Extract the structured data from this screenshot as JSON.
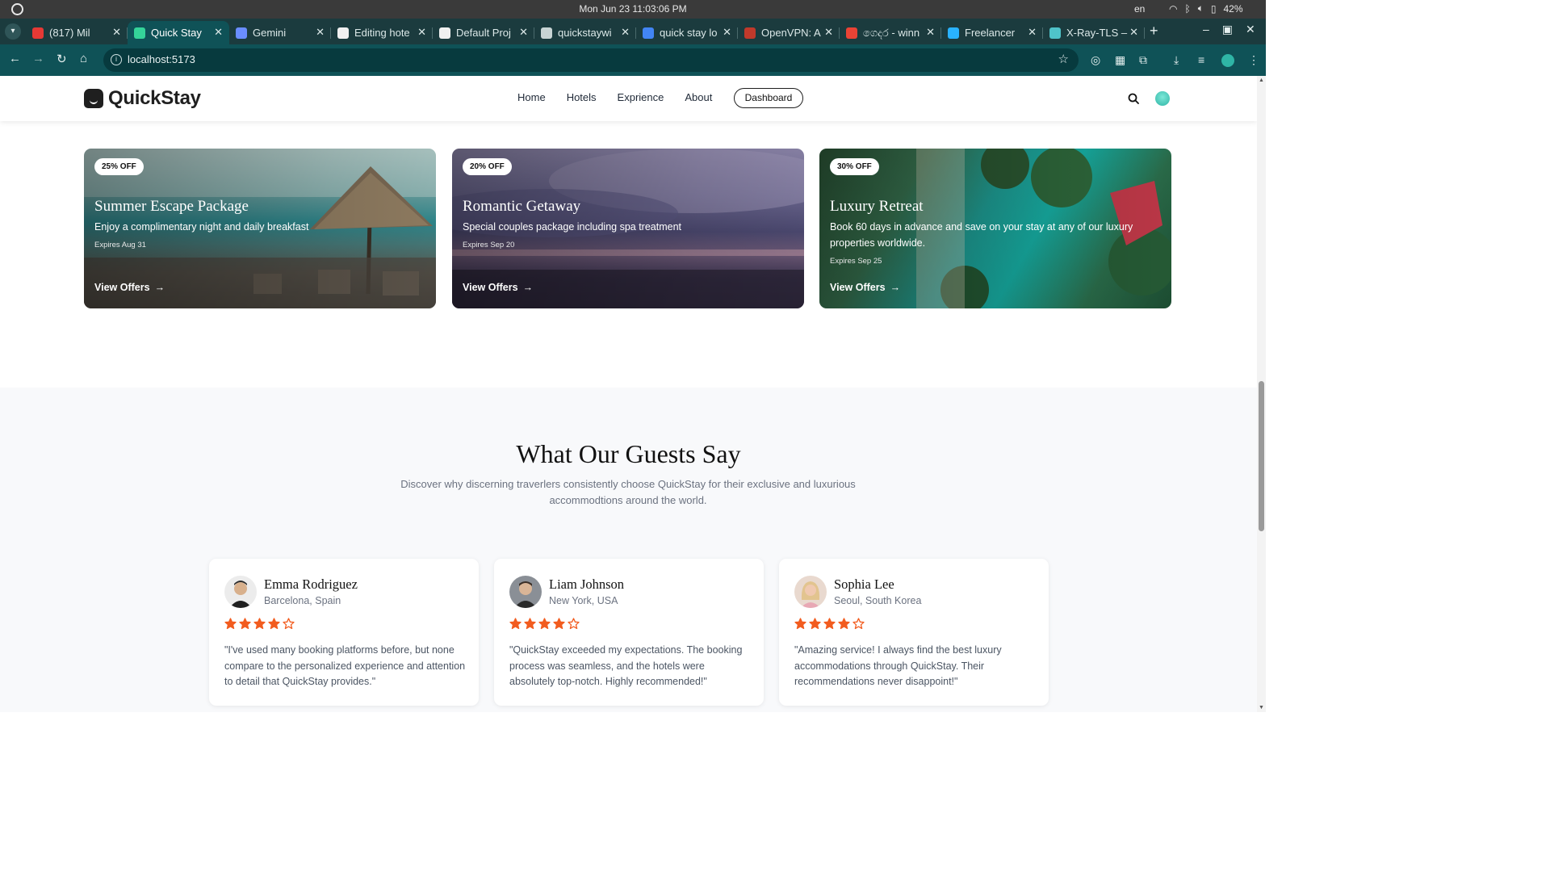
{
  "os": {
    "clock": "Mon Jun 23  11:03:06 PM",
    "lang": "en",
    "battery": "42%"
  },
  "tabs": [
    {
      "title": "(817) Mil",
      "favicon_color": "#e53935",
      "active": false
    },
    {
      "title": "Quick Stay",
      "favicon_color": "#34d399",
      "active": true
    },
    {
      "title": "Gemini",
      "favicon_color": "#6a8dff",
      "active": false
    },
    {
      "title": "Editing hote",
      "favicon_color": "#f0f0f0",
      "active": false
    },
    {
      "title": "Default Proj",
      "favicon_color": "#f0f0f0",
      "active": false
    },
    {
      "title": "quickstaywi",
      "favicon_color": "#c8d4d4",
      "active": false
    },
    {
      "title": "quick stay lo",
      "favicon_color": "#4285f4",
      "active": false
    },
    {
      "title": "OpenVPN: A",
      "favicon_color": "#c0392b",
      "active": false
    },
    {
      "title": "ගෙදර - winn",
      "favicon_color": "#ea4335",
      "active": false
    },
    {
      "title": "Freelancer",
      "favicon_color": "#29b2fe",
      "active": false
    },
    {
      "title": "X-Ray-TLS –",
      "favicon_color": "#4fc3c9",
      "active": false
    }
  ],
  "address_bar": {
    "url": "localhost:5173"
  },
  "site": {
    "brand": "QuickStay",
    "menu": [
      "Home",
      "Hotels",
      "Exprience",
      "About"
    ],
    "dashboard_label": "Dashboard"
  },
  "offers": [
    {
      "badge": "25% OFF",
      "title": "Summer Escape Package",
      "description": "Enjoy a complimentary night and daily breakfast",
      "expires": "Expires Aug 31",
      "link": "View Offers"
    },
    {
      "badge": "20% OFF",
      "title": "Romantic Getaway",
      "description": "Special couples package including spa treatment",
      "expires": "Expires Sep 20",
      "link": "View Offers"
    },
    {
      "badge": "30% OFF",
      "title": "Luxury Retreat",
      "description": "Book 60 days in advance and save on your stay at any of our luxury properties worldwide.",
      "expires": "Expires Sep 25",
      "link": "View Offers"
    }
  ],
  "testimonials_section": {
    "title": "What Our Guests Say",
    "subtitle": "Discover why discerning traverlers consistently choose QuickStay for their exclusive and luxurious accommodtions around the world."
  },
  "testimonials": [
    {
      "name": "Emma Rodriguez",
      "location": "Barcelona, Spain",
      "rating": 4,
      "max_rating": 5,
      "quote": "\"I've used many booking platforms before, but none compare to the personalized experience and attention to detail that QuickStay provides.\""
    },
    {
      "name": "Liam Johnson",
      "location": "New York, USA",
      "rating": 4,
      "max_rating": 5,
      "quote": "\"QuickStay exceeded my expectations. The booking process was seamless, and the hotels were absolutely top-notch. Highly recommended!\""
    },
    {
      "name": "Sophia Lee",
      "location": "Seoul, South Korea",
      "rating": 4,
      "max_rating": 5,
      "quote": "\"Amazing service! I always find the best luxury accommodations through QuickStay. Their recommendations never disappoint!\""
    }
  ],
  "colors": {
    "star": "#f25c1f",
    "browser_frame": "#0f5257"
  }
}
